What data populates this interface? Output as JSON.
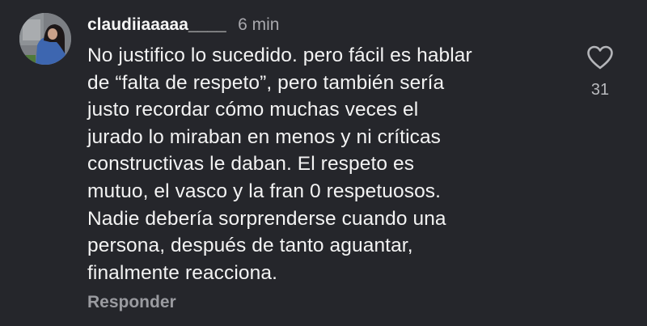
{
  "comment": {
    "username": "claudiiaaaaa____",
    "timestamp": "6 min",
    "body_lines": [
      "No justifico lo sucedido. pero fácil es hablar",
      "de “falta de respeto”, pero también sería",
      "justo recordar cómo muchas veces el",
      "jurado lo miraban en menos y ni críticas",
      "constructivas le daban. El respeto es",
      "mutuo, el vasco y la fran 0 respetuosos.",
      "Nadie debería sorprenderse cuando una",
      "persona, después de tanto aguantar,",
      "finalmente reacciona."
    ],
    "reply_label": "Responder",
    "like_count": "31",
    "like_icon": "heart-outline-icon"
  },
  "colors": {
    "background": "#25262b",
    "text": "#f3f3f3",
    "muted": "#a8a8ad"
  }
}
